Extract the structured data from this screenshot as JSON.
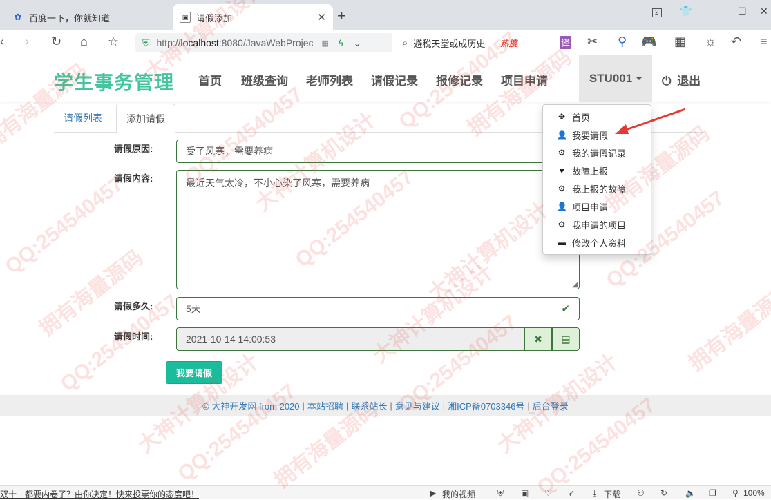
{
  "browser": {
    "tabs": [
      {
        "title": "百度一下，你就知道"
      },
      {
        "title": "请假添加"
      }
    ],
    "url_prefix": "http://",
    "url_host": "localhost",
    "url_rest": ":8080/JavaWebProjec",
    "search_placeholder": "避税天堂或成历史",
    "hot_label": "热搜",
    "tab_count": "2"
  },
  "nav": {
    "brand": "学生事务管理",
    "items": [
      "首页",
      "班级查询",
      "老师列表",
      "请假记录",
      "报修记录",
      "项目申请"
    ],
    "user": "STU001",
    "logout": "退出"
  },
  "subtabs": [
    "请假列表",
    "添加请假"
  ],
  "form": {
    "reason_label": "请假原因:",
    "reason_value": "受了风寒，需要养病",
    "content_label": "请假内容:",
    "content_value": "最近天气太冷，不小心染了风寒，需要养病",
    "duration_label": "请假多久:",
    "duration_value": "5天",
    "time_label": "请假时间:",
    "time_value": "2021-10-14 14:00:53",
    "submit": "我要请假"
  },
  "footer": {
    "copyright": "© 大神开发网 from 2020",
    "links": [
      "本站招聘",
      "联系站长",
      "意见与建议",
      "湘ICP备0703346号",
      "后台登录"
    ]
  },
  "dropdown": [
    {
      "icon": "move-icon",
      "label": "首页"
    },
    {
      "icon": "user-icon",
      "label": "我要请假"
    },
    {
      "icon": "cog-icon",
      "label": "我的请假记录"
    },
    {
      "icon": "heart-icon",
      "label": "故障上报"
    },
    {
      "icon": "cog-icon",
      "label": "我上报的故障"
    },
    {
      "icon": "user-icon",
      "label": "项目申请"
    },
    {
      "icon": "cog-icon",
      "label": "我申请的项目"
    },
    {
      "icon": "card-icon",
      "label": "修改个人资料"
    }
  ],
  "statusbar": {
    "news": "双十一都要内卷了？由你决定！快来投票你的态度吧！",
    "video": "我的视频",
    "download": "下载",
    "zoom": "100%"
  },
  "watermarks": [
    "QQ:254540457",
    "大神计算机设计",
    "拥有海量源码"
  ],
  "colors": {
    "brand": "#43c6a0",
    "submit": "#1abc9c",
    "valid": "#3c763d",
    "link": "#337ab7"
  }
}
